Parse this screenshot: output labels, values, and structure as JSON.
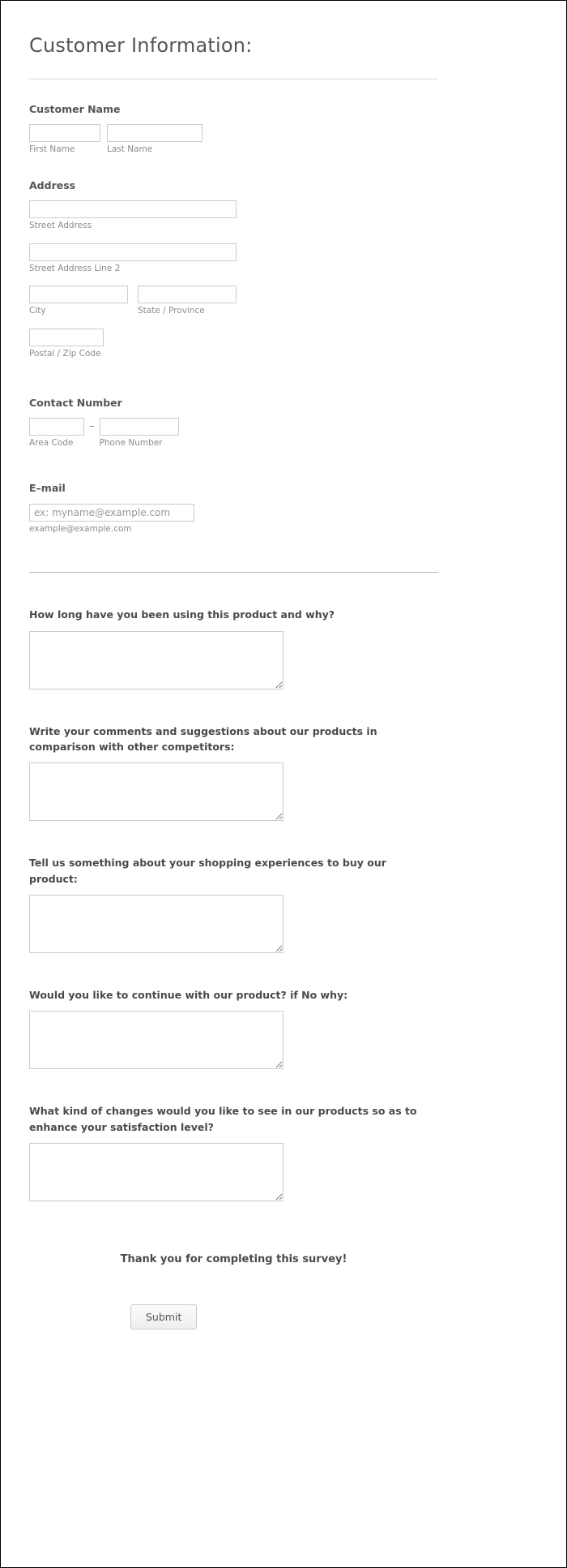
{
  "form": {
    "title": "Customer Information:",
    "sections": {
      "customer_name": {
        "label": "Customer Name",
        "first_name_sublabel": "First Name",
        "last_name_sublabel": "Last Name",
        "first_name_value": "",
        "last_name_value": ""
      },
      "address": {
        "label": "Address",
        "street_sublabel": "Street Address",
        "street2_sublabel": "Street Address Line 2",
        "city_sublabel": "City",
        "state_sublabel": "State / Province",
        "zip_sublabel": "Postal / Zip Code",
        "street_value": "",
        "street2_value": "",
        "city_value": "",
        "state_value": "",
        "zip_value": ""
      },
      "contact_number": {
        "label": "Contact Number",
        "area_code_sublabel": "Area Code",
        "phone_sublabel": "Phone Number",
        "separator": "–",
        "area_code_value": "",
        "phone_value": ""
      },
      "email": {
        "label": "E–mail",
        "placeholder": "ex: myname@example.com",
        "sublabel": "example@example.com",
        "value": ""
      }
    },
    "questions": [
      {
        "label": "How long have you been using this product and why?",
        "value": ""
      },
      {
        "label": "Write your comments and suggestions about our products in comparison with other competitors:",
        "value": ""
      },
      {
        "label": "Tell us something about your shopping experiences to buy our product:",
        "value": ""
      },
      {
        "label": "Would you like to continue with our product? if No why:",
        "value": ""
      },
      {
        "label": "What kind of changes would you like to see in our products so as to enhance your satisfaction level?",
        "value": ""
      }
    ],
    "footer": {
      "thank_you": "Thank you for completing this survey!",
      "submit_label": "Submit"
    },
    "colors": {
      "text": "#555555",
      "heading": "#4a4a4a",
      "sublabel": "#8b8b8b",
      "border": "#cccccc",
      "rule": "#b9b9b9",
      "page_background": "#ffffff"
    }
  }
}
